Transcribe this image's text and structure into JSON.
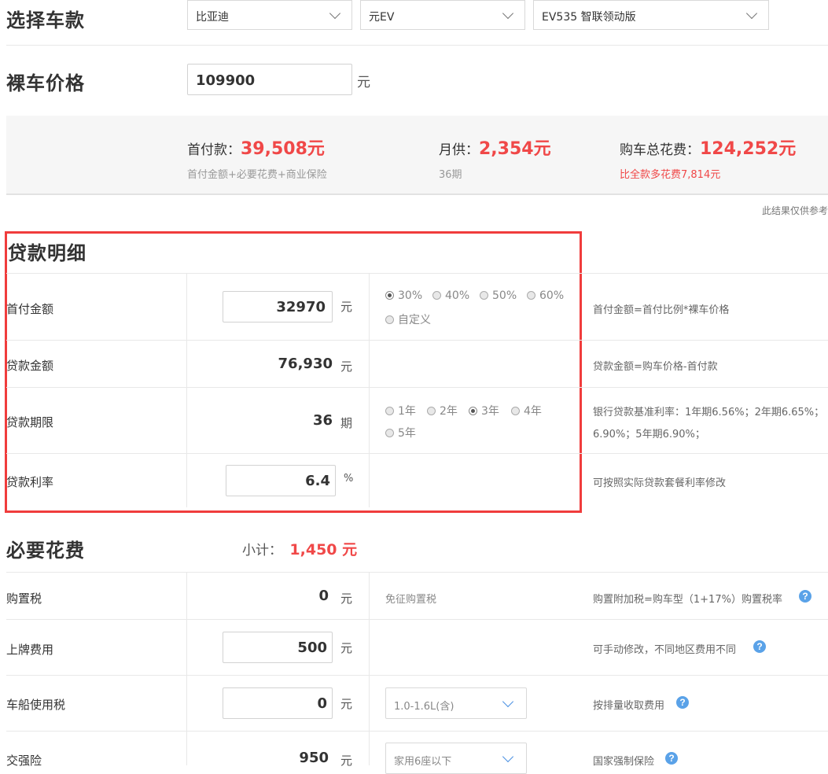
{
  "car_select": {
    "title": "选择车款",
    "brand": "比亚迪",
    "series": "元EV",
    "model": "EV535 智联领动版"
  },
  "price": {
    "title": "裸车价格",
    "value": "109900",
    "unit": "元"
  },
  "summary": {
    "down_label": "首付款：",
    "down_value": "39,508元",
    "down_note": "首付金额+必要花费+商业保险",
    "monthly_label": "月供：",
    "monthly_value": "2,354元",
    "monthly_note": "36期",
    "total_label": "购车总花费：",
    "total_value": "124,252元",
    "total_note": "比全款多花费7,814元",
    "disclaimer": "此结果仅供参考"
  },
  "loan": {
    "title": "贷款明细",
    "rows": [
      {
        "label": "首付金额",
        "value": "32970",
        "unit": "元",
        "note": "首付金额=首付比例*裸车价格"
      },
      {
        "label": "贷款金额",
        "value": "76,930",
        "unit": "元",
        "note": "贷款金额=购车价格-首付款"
      },
      {
        "label": "贷款期限",
        "value": "36",
        "unit": "期",
        "note_line1": "银行贷款基准利率：1年期6.56%；2年期6.65%；",
        "note_line2": "6.90%；5年期6.90%；"
      },
      {
        "label": "贷款利率",
        "value": "6.4",
        "unit": "%",
        "note": "可按照实际贷款套餐利率修改"
      }
    ],
    "ratio_options": [
      "30%",
      "40%",
      "50%",
      "60%",
      "自定义"
    ],
    "ratio_selected": "30%",
    "term_options": [
      "1年",
      "2年",
      "3年",
      "4年",
      "5年"
    ],
    "term_selected": "3年"
  },
  "fees": {
    "title": "必要花费",
    "subtotal_label": "小计：",
    "subtotal_value": "1,450 元",
    "rows": [
      {
        "label": "购置税",
        "value": "0",
        "unit": "元",
        "middle": "免征购置税",
        "note": "购置附加税=购车型（1+17%）购置税率"
      },
      {
        "label": "上牌费用",
        "value": "500",
        "unit": "元",
        "note": "可手动修改，不同地区费用不同"
      },
      {
        "label": "车船使用税",
        "value": "0",
        "unit": "元",
        "select": "1.0-1.6L(含)",
        "note": "按排量收取费用"
      },
      {
        "label": "交强险",
        "value": "950",
        "unit": "元",
        "select": "家用6座以下",
        "note": "国家强制保险"
      }
    ]
  },
  "colors": {
    "accent_red": "#f04848",
    "highlight_border": "#f03c3c",
    "help_icon": "#5aa2e8"
  }
}
